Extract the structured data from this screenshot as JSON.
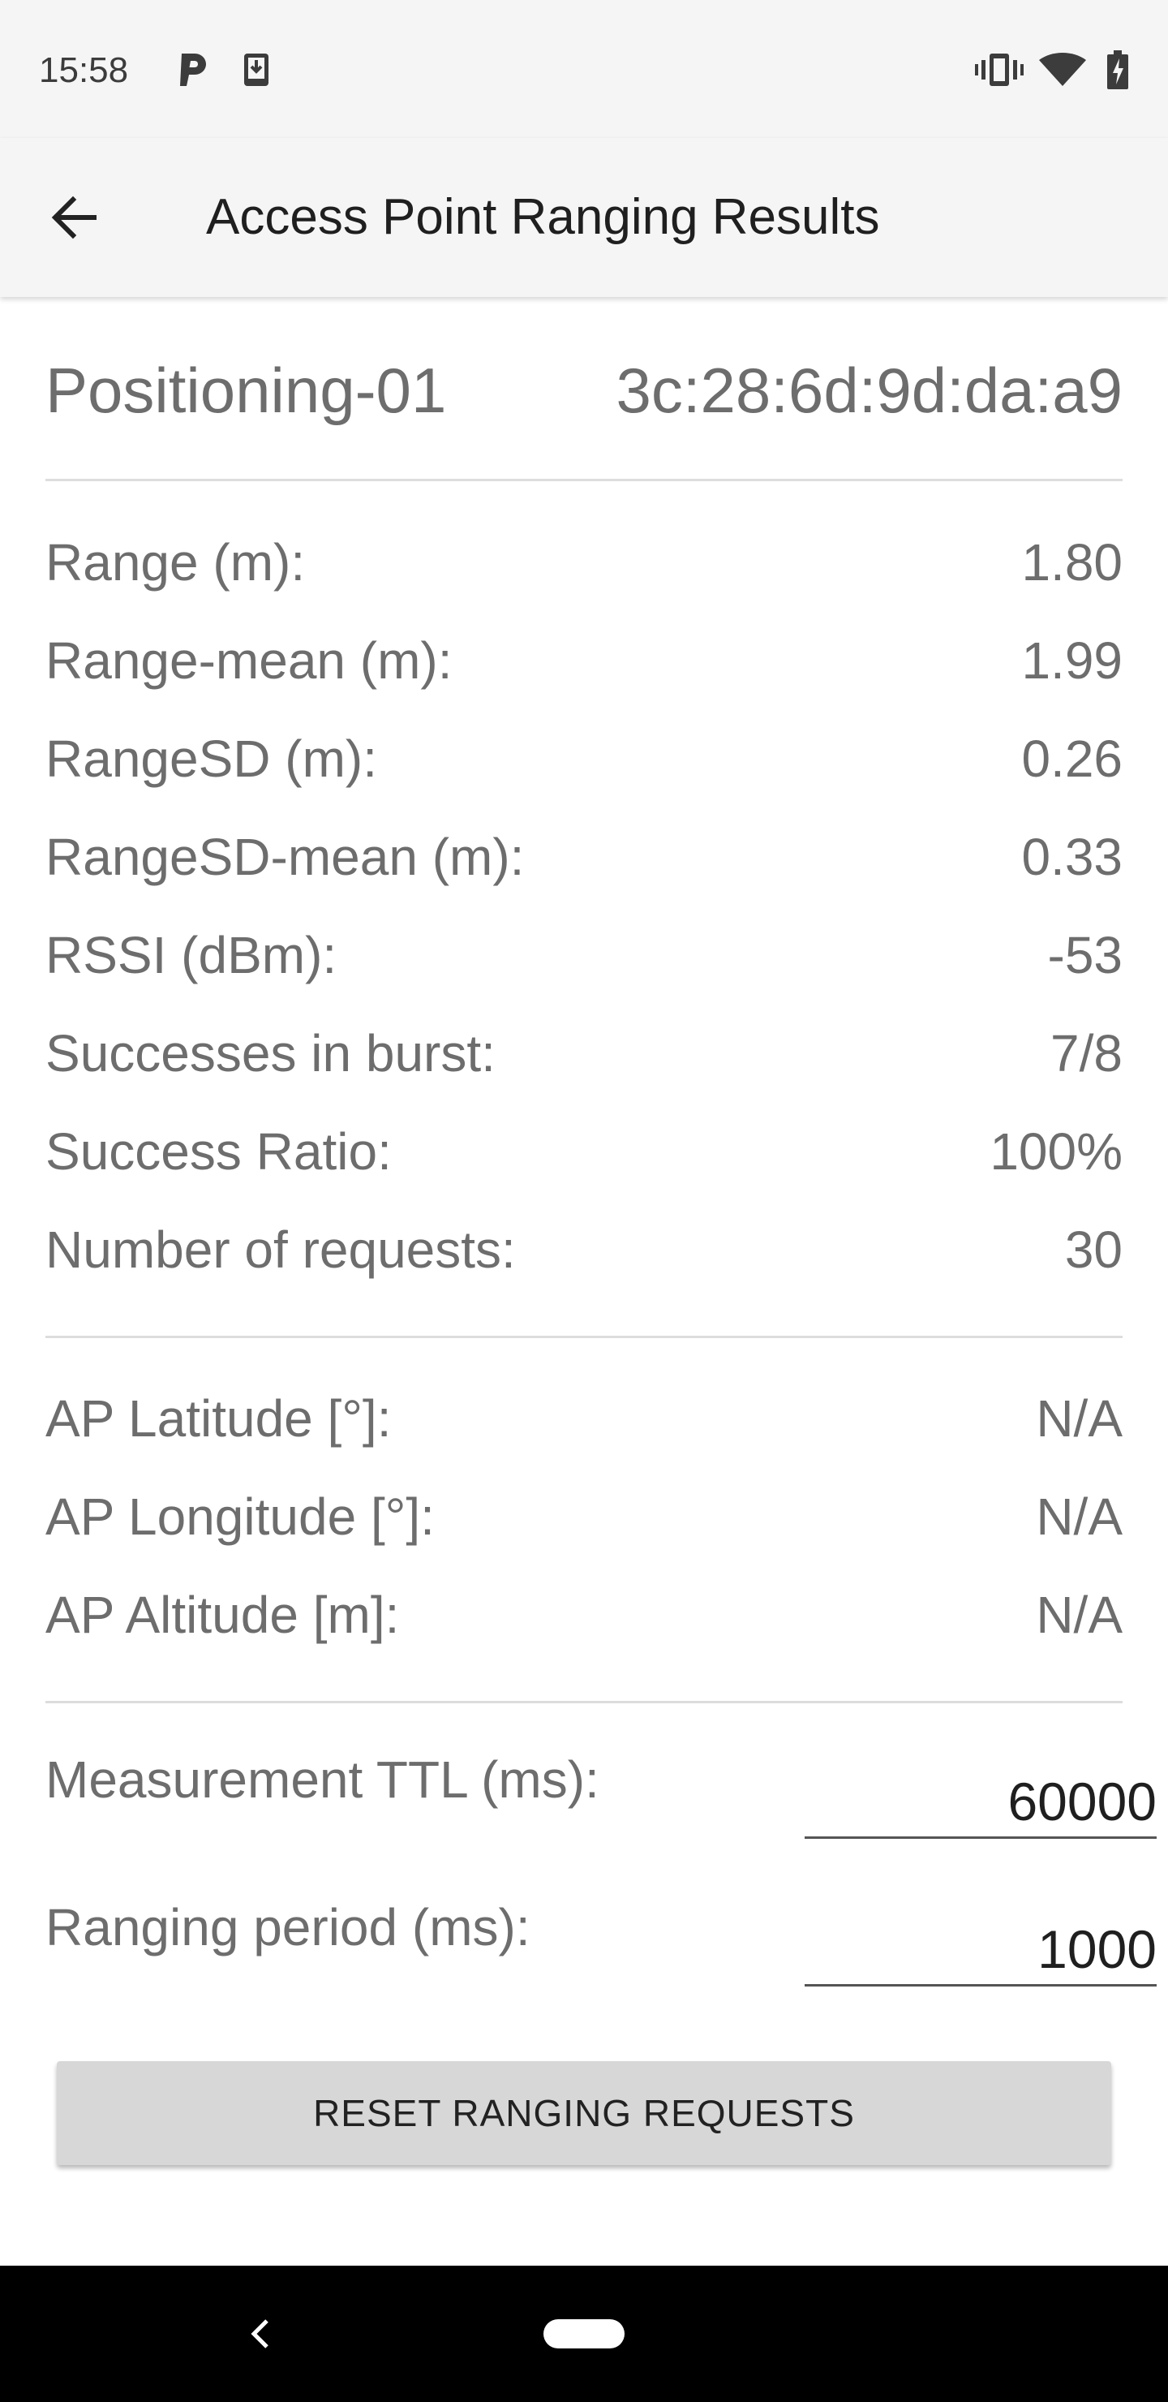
{
  "status_bar": {
    "time": "15:58",
    "icons_left": [
      "parking-icon",
      "download-icon"
    ],
    "icons_right": [
      "vibrate-icon",
      "wifi-icon",
      "battery-charging-icon"
    ]
  },
  "app_bar": {
    "title": "Access Point Ranging Results",
    "back_icon": "arrow-back-icon"
  },
  "access_point": {
    "ssid": "Positioning-01",
    "bssid": "3c:28:6d:9d:da:a9"
  },
  "stats": [
    {
      "label": "Range (m):",
      "value": "1.80"
    },
    {
      "label": "Range-mean (m):",
      "value": "1.99"
    },
    {
      "label": "RangeSD (m):",
      "value": "0.26"
    },
    {
      "label": "RangeSD-mean (m):",
      "value": "0.33"
    },
    {
      "label": "RSSI (dBm):",
      "value": "-53"
    },
    {
      "label": "Successes in burst:",
      "value": "7/8"
    },
    {
      "label": "Success Ratio:",
      "value": "100%"
    },
    {
      "label": "Number of requests:",
      "value": "30"
    }
  ],
  "location": [
    {
      "label": "AP Latitude [°]:",
      "value": "N/A"
    },
    {
      "label": "AP Longitude [°]:",
      "value": "N/A"
    },
    {
      "label": "AP Altitude [m]:",
      "value": "N/A"
    }
  ],
  "settings": {
    "ttl_label": "Measurement TTL (ms):",
    "ttl_value": "60000",
    "period_label": "Ranging period (ms):",
    "period_value": "1000"
  },
  "reset_button": "RESET RANGING REQUESTS",
  "nav_bar": {
    "back_icon": "nav-back-icon",
    "home_icon": "home-pill-icon"
  },
  "colors": {
    "bar_background": "#f5f5f5",
    "text_secondary": "#6d6d6d",
    "button_background": "#d7d7d7",
    "nav_background": "#000000"
  }
}
